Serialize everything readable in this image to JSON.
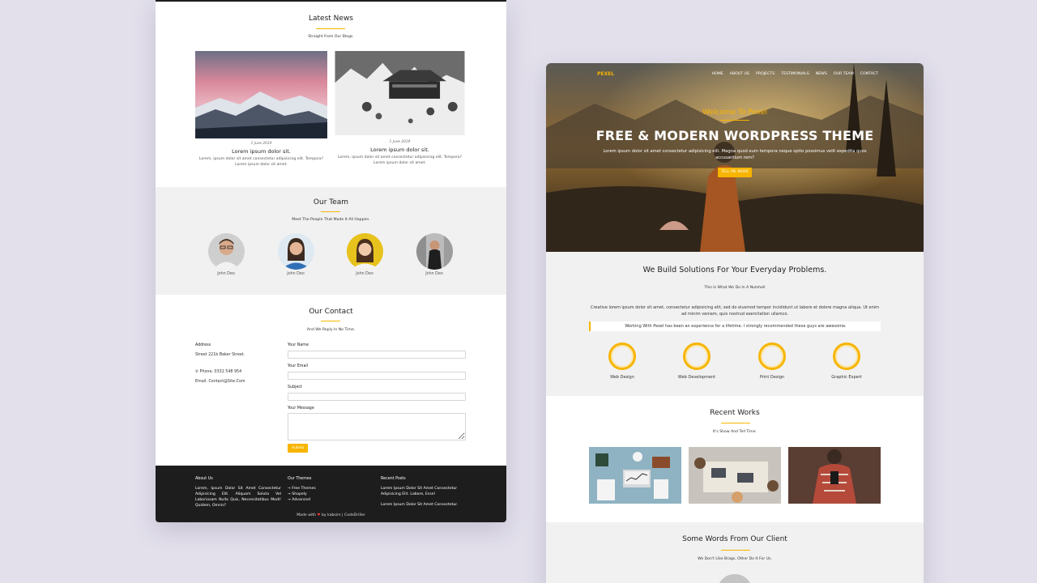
{
  "colors": {
    "accent": "#f7b500",
    "background": "#e3e0ec",
    "footer": "#1d1d1d",
    "section_gray": "#f1f1f1"
  },
  "left": {
    "news": {
      "title": "Latest News",
      "subtitle": "Straight From Our Blogs.",
      "posts": [
        {
          "date": "1 June 2019",
          "title": "Lorem ipsum dolor sit.",
          "text": "Lorem, ipsum dolor sit amet consectetur adipisicing elit. Tempora? Lorem ipsum dolor sit amet.",
          "image": "pink-sky-mountains"
        },
        {
          "date": "1 June 2019",
          "title": "Lorem ipsum dolor sit.",
          "text": "Lorem, ipsum dolor sit amet consectetur adipisicing elit. Tempora? Lorem ipsum dolor sit amet.",
          "image": "snowy-japanese-house"
        }
      ]
    },
    "team": {
      "title": "Our Team",
      "subtitle": "Meet The People That Made It All Happen.",
      "members": [
        {
          "name": "John Deo",
          "avatar": "man-glasses"
        },
        {
          "name": "John Deo",
          "avatar": "woman-blue"
        },
        {
          "name": "John Deo",
          "avatar": "woman-yellow"
        },
        {
          "name": "John Deo",
          "avatar": "man-street"
        }
      ]
    },
    "contact": {
      "title": "Our Contact",
      "subtitle": "And We Reply In No Time.",
      "address_label": "Address",
      "address": "Street 221b Baker Street.",
      "phone": "Phone: 0332 548 954",
      "email": "Email: Contact@Site.Com",
      "form": {
        "name_label": "Your Name",
        "email_label": "Your Email",
        "subject_label": "Subject",
        "message_label": "Your Message",
        "submit": "Submit"
      }
    },
    "footer": {
      "about_title": "About Us",
      "about_text": "Lorem, Ipsum Dolor Sit Amet Consectetur Adipisicing Elit. Aliquam Soluta Vel Laboriosam Nulla Quis, Necessitatibus Modi! Quidem, Omnis?",
      "themes_title": "Our Themes",
      "themes": [
        "→ Free Themes",
        "→ Shapely",
        "→ Advanced"
      ],
      "posts_title": "Recent Posts",
      "posts": [
        "Lorem Ipsum Dolor Sit Amet Consectetur Adipisicing Elit. Labore, Esse!",
        "Lorem Ipsum Dolor Sit Amet Consectetur."
      ],
      "credits_pre": "Made with",
      "credits_heart": "♥",
      "credits_post": "by kabsim | CodeDriller"
    }
  },
  "right": {
    "nav": {
      "brand": "PEXEL",
      "links": [
        "HOME",
        "ABOUT US",
        "PROJECTS",
        "TESTIMONIALS",
        "NEWS",
        "OUR TEAM",
        "CONTACT"
      ]
    },
    "hero": {
      "kicker": "Welcome To Pexel",
      "title": "FREE & MODERN WORDPRESS THEME",
      "text": "Lorem ipsum dolor sit amet consectetur adipisicing elit. Magna quod eum tempora neque optio possimus velit expedita quos accusantium rem?",
      "button": "TELL ME MORE"
    },
    "solutions": {
      "title": "We Build Solutions For Your Everyday Problems.",
      "subtitle": "This Is What We Do In A Nutshell",
      "text": "Creative lorem ipsum dolor sit amet, consectetur adipisicing elit, sed do eiusmod tempor incididunt ut labore et dolore magna aliqua. Ut enim ad minim veniam, quis nostrud exercitation ullamco.",
      "quote": "Working With Pexel has been an experience for a lifetime. I strongly recommended these guys are awesome.",
      "skills": [
        "Web Design",
        "Web Development",
        "Print Design",
        "Graphic Expert"
      ]
    },
    "works": {
      "title": "Recent Works",
      "subtitle": "It's Show And Tell Time.",
      "items": [
        "laptop-desk",
        "meeting-table",
        "man-phone"
      ]
    },
    "clients": {
      "title": "Some Words From Our Client",
      "subtitle": "We Don't Like Brags, Other Do It For Us."
    }
  }
}
